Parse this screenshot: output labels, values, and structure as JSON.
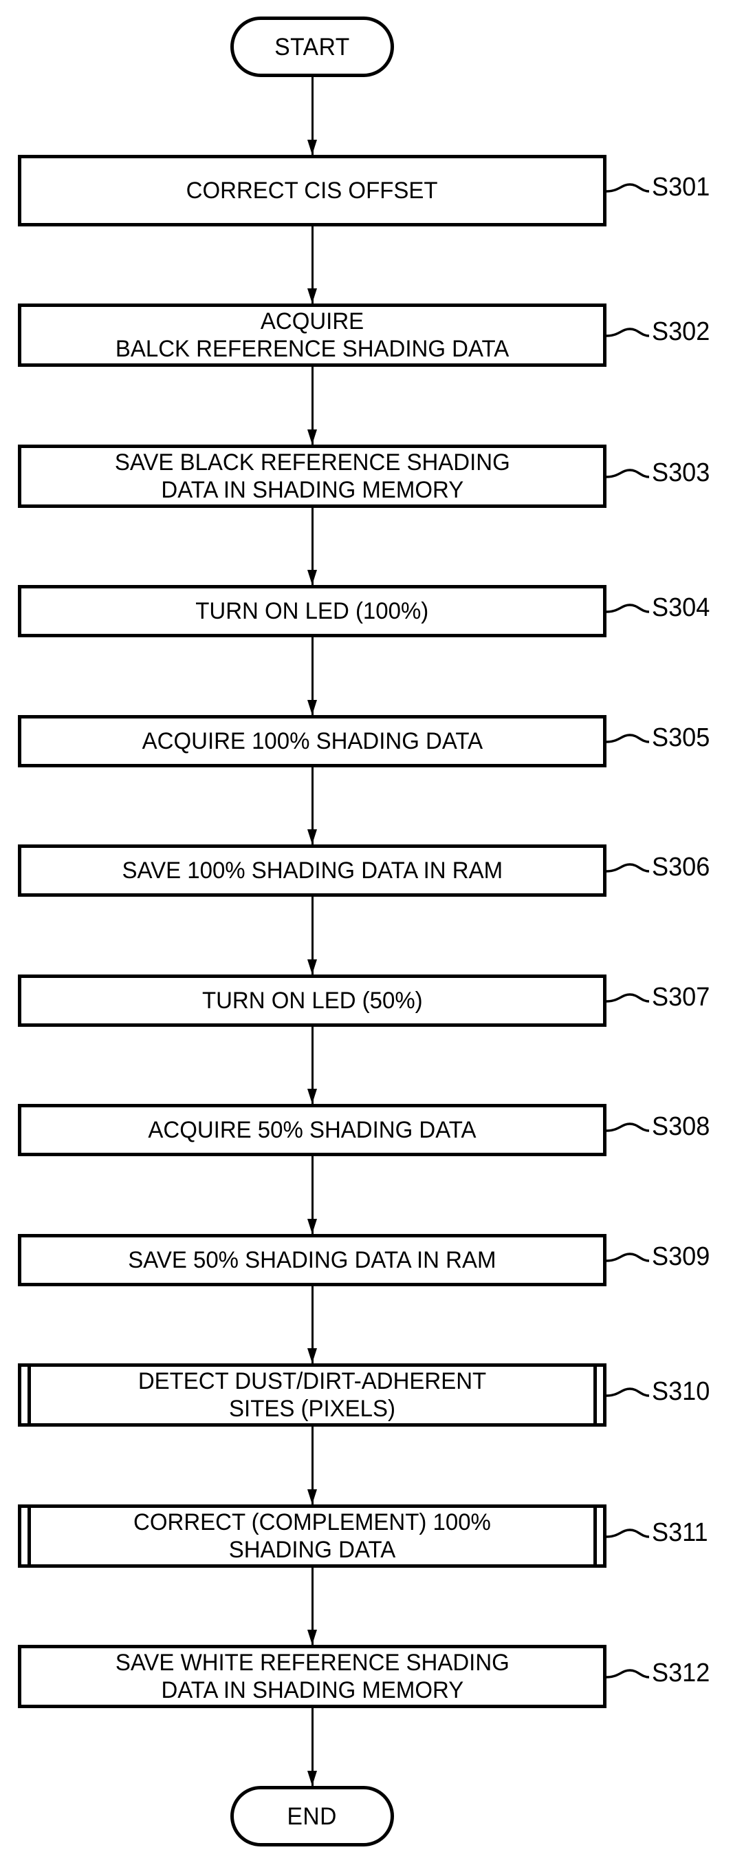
{
  "figure": {
    "type": "flowchart",
    "orientation": "vertical",
    "start_label": "START",
    "end_label": "END"
  },
  "nodes": [
    {
      "id": "S301",
      "ref": "S301",
      "shape": "process",
      "text": "CORRECT CIS OFFSET"
    },
    {
      "id": "S302",
      "ref": "S302",
      "shape": "process",
      "text": "ACQUIRE\nBALCK REFERENCE SHADING DATA"
    },
    {
      "id": "S303",
      "ref": "S303",
      "shape": "process",
      "text": "SAVE BLACK REFERENCE SHADING\nDATA IN SHADING MEMORY"
    },
    {
      "id": "S304",
      "ref": "S304",
      "shape": "process",
      "text": "TURN ON LED (100%)"
    },
    {
      "id": "S305",
      "ref": "S305",
      "shape": "process",
      "text": "ACQUIRE 100% SHADING DATA"
    },
    {
      "id": "S306",
      "ref": "S306",
      "shape": "process",
      "text": "SAVE 100% SHADING DATA IN RAM"
    },
    {
      "id": "S307",
      "ref": "S307",
      "shape": "process",
      "text": "TURN ON LED (50%)"
    },
    {
      "id": "S308",
      "ref": "S308",
      "shape": "process",
      "text": "ACQUIRE 50% SHADING DATA"
    },
    {
      "id": "S309",
      "ref": "S309",
      "shape": "process",
      "text": "SAVE 50% SHADING DATA IN RAM"
    },
    {
      "id": "S310",
      "ref": "S310",
      "shape": "predefined-process",
      "text": "DETECT DUST/DIRT-ADHERENT\nSITES (PIXELS)"
    },
    {
      "id": "S311",
      "ref": "S311",
      "shape": "predefined-process",
      "text": "CORRECT (COMPLEMENT) 100%\nSHADING DATA"
    },
    {
      "id": "S312",
      "ref": "S312",
      "shape": "process",
      "text": "SAVE WHITE REFERENCE SHADING\nDATA IN SHADING MEMORY"
    }
  ],
  "colors": {
    "stroke": "#000000",
    "fill": "#ffffff",
    "text": "#000000"
  }
}
